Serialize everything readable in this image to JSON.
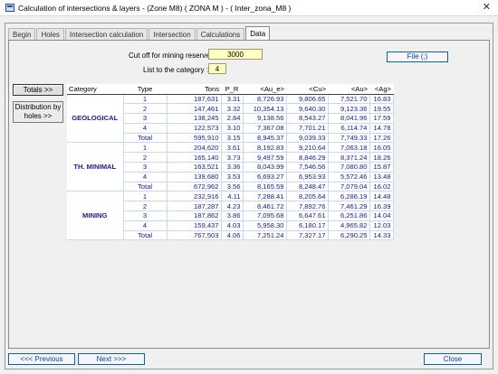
{
  "window": {
    "title": "Calculation of intersections & layers - (Zone M8) ( ZONA M ) - ( Inter_zona_M8 )",
    "close_glyph": "✕"
  },
  "tabs": [
    "Begin",
    "Holes",
    "Intersection calculation",
    "Intersection",
    "Calculations",
    "Data"
  ],
  "active_tab": "Data",
  "form": {
    "cutoff_label": "Cut off for mining reserves",
    "cutoff_value": "3000",
    "category_label": "List to the category :",
    "category_value": "4"
  },
  "buttons": {
    "file": "File (;)",
    "totals": "Totals >>",
    "distribution": "Distribution by holes >>",
    "previous": "<<< Previous",
    "next": "Next >>>",
    "close": "Close"
  },
  "table": {
    "headers": [
      "Category",
      "Type",
      "Tons",
      "P_R",
      "<Au_e>",
      "<Cu>",
      "<Au>",
      "<Ag>"
    ],
    "groups": [
      {
        "category": "GEOLOGICAL",
        "rows": [
          [
            "1",
            "187,631",
            "3.31",
            "8,726.93",
            "9,806.65",
            "7,521.70",
            "16.83"
          ],
          [
            "2",
            "147,461",
            "3.32",
            "10,354.13",
            "9,640.30",
            "9,123.36",
            "19.55"
          ],
          [
            "3",
            "138,245",
            "2.84",
            "9,138.56",
            "8,543.27",
            "8,041.96",
            "17.59"
          ],
          [
            "4",
            "122,573",
            "3.10",
            "7,367.08",
            "7,701.21",
            "6,114.74",
            "14.78"
          ],
          [
            "Total",
            "595,910",
            "3.15",
            "8,945.37",
            "9,039.33",
            "7,749.33",
            "17.26"
          ]
        ]
      },
      {
        "category": "TH. MINIMAL",
        "rows": [
          [
            "1",
            "204,620",
            "3.61",
            "8,192.83",
            "9,210.64",
            "7,063.18",
            "16.05"
          ],
          [
            "2",
            "165,140",
            "3.73",
            "9,497.59",
            "8,846.29",
            "8,371.24",
            "18.26"
          ],
          [
            "3",
            "163,521",
            "3.36",
            "8,043.99",
            "7,546.56",
            "7,080.80",
            "15.87"
          ],
          [
            "4",
            "139,680",
            "3.53",
            "6,693.27",
            "6,953.93",
            "5,572.46",
            "13.48"
          ],
          [
            "Total",
            "672,962",
            "3.56",
            "8,165.59",
            "8,248.47",
            "7,079.04",
            "16.02"
          ]
        ]
      },
      {
        "category": "MINING",
        "rows": [
          [
            "1",
            "232,916",
            "4.11",
            "7,288.41",
            "8,205.64",
            "6,286.19",
            "14.48"
          ],
          [
            "2",
            "187,287",
            "4.23",
            "8,461.72",
            "7,892.76",
            "7,461.29",
            "16.39"
          ],
          [
            "3",
            "187,862",
            "3.86",
            "7,095.68",
            "6,647.61",
            "6,251.86",
            "14.04"
          ],
          [
            "4",
            "159,437",
            "4.03",
            "5,958.30",
            "6,180.17",
            "4,965.82",
            "12.03"
          ],
          [
            "Total",
            "767,503",
            "4.06",
            "7,251.24",
            "7,327.17",
            "6,290.25",
            "14.33"
          ]
        ]
      }
    ]
  }
}
